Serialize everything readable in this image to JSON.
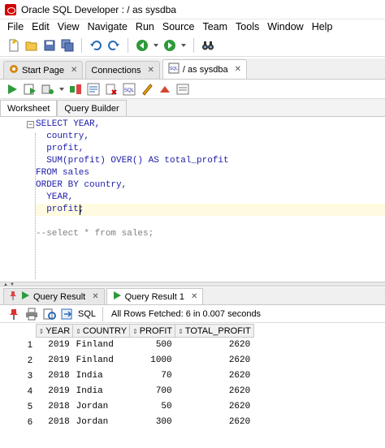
{
  "window": {
    "title": "Oracle SQL Developer : / as sysdba"
  },
  "menu": [
    "File",
    "Edit",
    "View",
    "Navigate",
    "Run",
    "Source",
    "Team",
    "Tools",
    "Window",
    "Help"
  ],
  "doc_tabs": [
    {
      "label": "Start Page",
      "icon": "start-page-icon"
    },
    {
      "label": "Connections",
      "icon": "connections-icon"
    },
    {
      "label": "/ as sysdba",
      "icon": "sql-worksheet-icon",
      "active": true
    }
  ],
  "sub_tabs": [
    "Worksheet",
    "Query Builder"
  ],
  "editor": {
    "lines": [
      {
        "text": "SELECT YEAR,",
        "kw": "SELECT"
      },
      {
        "text": "  country,"
      },
      {
        "text": "  profit,"
      },
      {
        "text": "  SUM(profit) OVER() AS total_profit"
      },
      {
        "text": "FROM sales"
      },
      {
        "text": "ORDER BY country,"
      },
      {
        "text": "  YEAR,"
      },
      {
        "text": "  profit;"
      },
      {
        "text": ""
      },
      {
        "text": "--select * from sales;"
      }
    ]
  },
  "result_tabs": [
    {
      "label": "Query Result",
      "active": false
    },
    {
      "label": "Query Result 1",
      "active": true
    }
  ],
  "result_toolbar": {
    "sql_label": "SQL",
    "status": "All Rows Fetched: 6 in 0.007 seconds"
  },
  "grid": {
    "columns": [
      "YEAR",
      "COUNTRY",
      "PROFIT",
      "TOTAL_PROFIT"
    ],
    "rows": [
      [
        "1",
        "2019",
        "Finland",
        "500",
        "2620"
      ],
      [
        "2",
        "2019",
        "Finland",
        "1000",
        "2620"
      ],
      [
        "3",
        "2018",
        "India",
        "70",
        "2620"
      ],
      [
        "4",
        "2019",
        "India",
        "700",
        "2620"
      ],
      [
        "5",
        "2018",
        "Jordan",
        "50",
        "2620"
      ],
      [
        "6",
        "2018",
        "Jordan",
        "300",
        "2620"
      ]
    ]
  },
  "colors": {
    "keyword": "#1c1ca8",
    "comment": "#808080",
    "current_line": "#fffbe0"
  }
}
